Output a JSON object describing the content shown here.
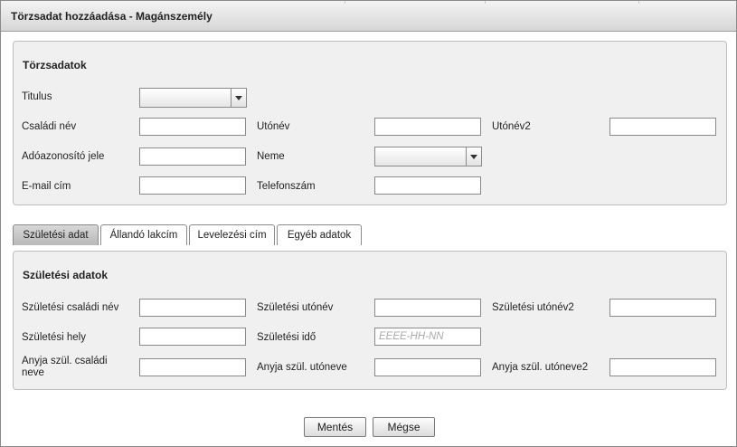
{
  "dialog": {
    "title": "Törzsadat hozzáadása - Magánszemély"
  },
  "master": {
    "heading": "Törzsadatok",
    "titulus_label": "Titulus",
    "family_name_label": "Családi név",
    "given_name_label": "Utónév",
    "given_name2_label": "Utónév2",
    "tax_id_label": "Adóazonosító jele",
    "gender_label": "Neme",
    "email_label": "E-mail cím",
    "phone_label": "Telefonszám"
  },
  "tabs": [
    {
      "label": "Születési adat",
      "active": true
    },
    {
      "label": "Állandó lakcím",
      "active": false
    },
    {
      "label": "Levelezési cím",
      "active": false
    },
    {
      "label": "Egyéb adatok",
      "active": false
    }
  ],
  "birth": {
    "heading": "Születési adatok",
    "birth_family_name_label": "Születési családi név",
    "birth_given_name_label": "Születési utónév",
    "birth_given_name2_label": "Születési utónév2",
    "birth_place_label": "Születési hely",
    "birth_date_label": "Születési idő",
    "birth_date_placeholder": "ÉÉÉÉ-HH-NN",
    "mother_family_name_label_line1": "Anyja szül. családi",
    "mother_family_name_label_line2": "neve",
    "mother_given_name_label": "Anyja szül. utóneve",
    "mother_given_name2_label": "Anyja szül. utóneve2"
  },
  "buttons": {
    "save": "Mentés",
    "cancel": "Mégse"
  }
}
